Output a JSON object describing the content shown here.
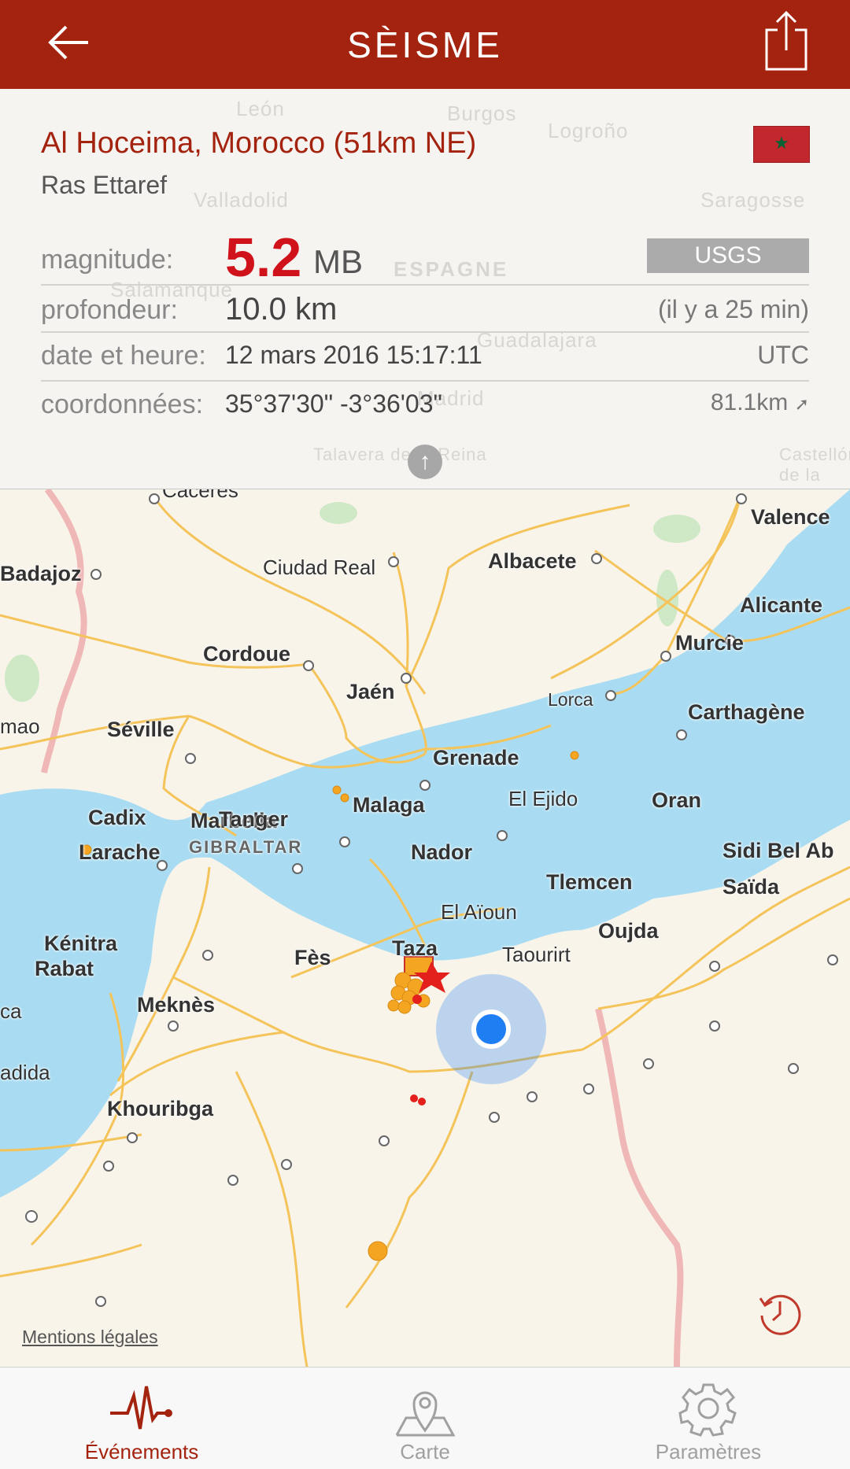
{
  "header": {
    "title": "SÈISME",
    "back_icon": "arrow-left-icon",
    "share_icon": "share-icon"
  },
  "event": {
    "title": "Al Hoceima, Morocco (51km NE)",
    "subtitle": "Ras Ettaref",
    "flag_icon": "morocco-flag-icon",
    "magnitude_label": "magnitude:",
    "magnitude_value": "5.2",
    "magnitude_unit": "MB",
    "source": "USGS",
    "depth_label": "profondeur:",
    "depth_value": "10.0 km",
    "time_ago": "(il y a 25 min)",
    "datetime_label": "date et heure:",
    "datetime_value": "12 mars 2016 15:17:11",
    "timezone": "UTC",
    "coords_label": "coordonnées:",
    "coords_value": "35°37'30\"  -3°36'03\"",
    "distance": "81.1km"
  },
  "background_map_labels": [
    "León",
    "Burgos",
    "Logroño",
    "Valladolid",
    "Saragosse",
    "ESPAGNE",
    "Salamanque",
    "Guadalajara",
    "Madrid",
    "Talavera de la Reina",
    "Castellón de la Plana"
  ],
  "map": {
    "labels": [
      "Cáceres",
      "Valence",
      "Badajoz",
      "Ciudad Real",
      "Albacete",
      "Alicante",
      "Cordoue",
      "Murcie",
      "Jaén",
      "Lorca",
      "Carthagène",
      "Séville",
      "Grenade",
      "El Ejido",
      "Malaga",
      "Cadix",
      "Marbella",
      "GIBRALTAR",
      "Oran",
      "Tanger",
      "Larache",
      "Nador",
      "Tlemcen",
      "Sidi Bel Ab",
      "Saïda",
      "El Aïoun",
      "Oujda",
      "Kénitra",
      "Rabat",
      "Taza",
      "Taourirt",
      "Fès",
      "Meknès",
      "Khouribga",
      "mao",
      "ca",
      "adida"
    ],
    "legal": "Mentions légales",
    "history_icon": "history-clock-icon",
    "colors": {
      "sea": "#a9dcf2",
      "land": "#f8f4ea",
      "roads": "#f4c45a",
      "user_location": "#1e7ef2",
      "quake_orange": "#f4a623",
      "quake_red": "#e3201b"
    }
  },
  "tabs": [
    {
      "label": "Événements",
      "icon": "seismograph-icon",
      "active": true
    },
    {
      "label": "Carte",
      "icon": "map-pin-icon",
      "active": false
    },
    {
      "label": "Paramètres",
      "icon": "gear-icon",
      "active": false
    }
  ]
}
